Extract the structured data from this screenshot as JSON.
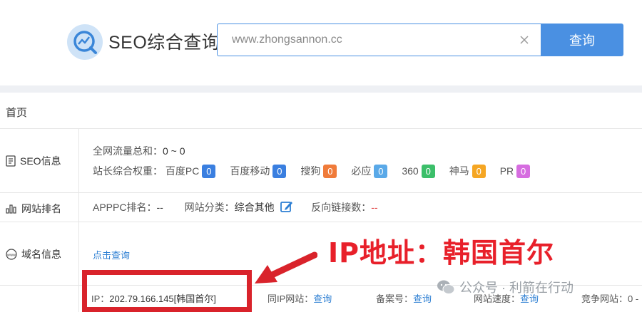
{
  "header": {
    "logo_text": "SEO综合查询",
    "search_value": "www.zhongsannon.cc",
    "search_button": "查询"
  },
  "breadcrumb": "首页",
  "sidebar": {
    "seo_info": "SEO信息",
    "site_rank": "网站排名",
    "domain_info": "域名信息"
  },
  "seo": {
    "traffic_label": "全网流量总和：",
    "traffic_value": "0 ~ 0",
    "weight_label": "站长综合权重：",
    "engines": [
      {
        "name": "百度PC",
        "value": "0",
        "color": "#3a7fe0"
      },
      {
        "name": "百度移动",
        "value": "0",
        "color": "#3a7fe0"
      },
      {
        "name": "搜狗",
        "value": "0",
        "color": "#f07b3a"
      },
      {
        "name": "必应",
        "value": "0",
        "color": "#5aa9e8"
      },
      {
        "name": "360",
        "value": "0",
        "color": "#3cbf6a"
      },
      {
        "name": "神马",
        "value": "0",
        "color": "#f5a623"
      },
      {
        "name": "PR",
        "value": "0",
        "color": "#d66de0"
      }
    ]
  },
  "rank": {
    "apppc_label": "APPPC排名：",
    "apppc_value": "--",
    "category_label": "网站分类：",
    "category_value": "综合其他",
    "backlinks_label": "反向链接数：",
    "backlinks_value": "--"
  },
  "domain": {
    "click_query": "点击查询",
    "ip_label": "IP：",
    "ip_value": "202.79.166.145[韩国首尔]",
    "same_ip_label": "同IP网站：",
    "same_ip_link": "查询",
    "icp_label": "备案号：",
    "icp_link": "查询",
    "speed_label": "网站速度：",
    "speed_link": "查询",
    "competitor_label": "竞争网站：",
    "competitor_value": "0 -"
  },
  "annotation": "IP地址：韩国首尔",
  "watermark": "公众号 · 利箭在行动"
}
